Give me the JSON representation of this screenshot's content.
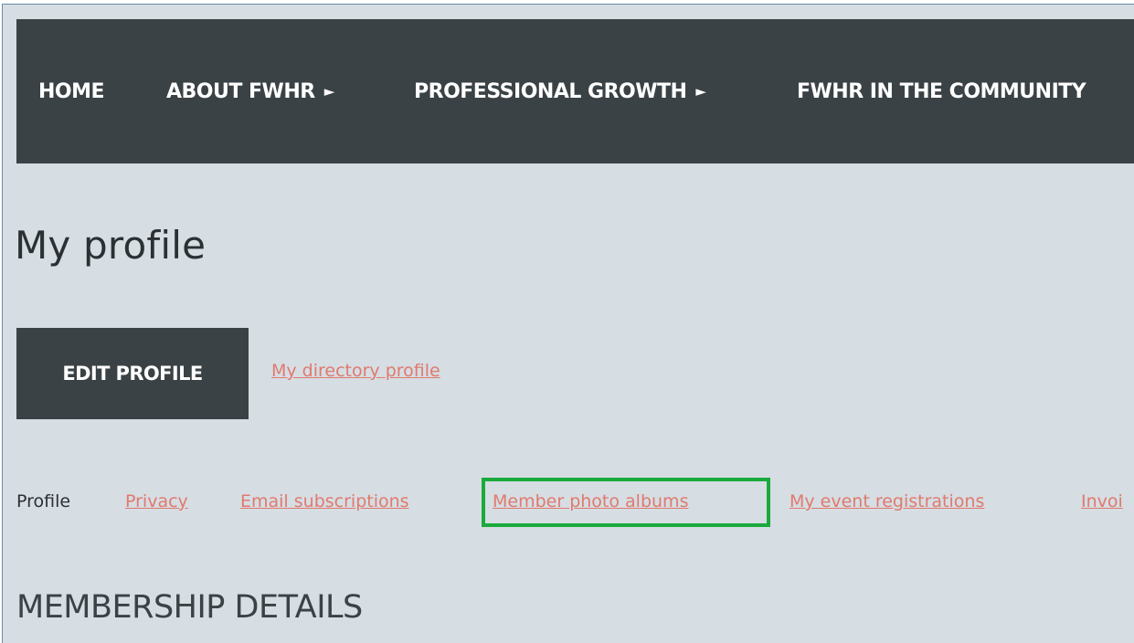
{
  "nav": {
    "items": [
      {
        "label": "HOME",
        "has_submenu": false,
        "arrow": ""
      },
      {
        "label": "ABOUT FWHR",
        "has_submenu": true,
        "arrow": "►"
      },
      {
        "label": "PROFESSIONAL GROWTH",
        "has_submenu": true,
        "arrow": "►"
      },
      {
        "label": "FWHR IN THE COMMUNITY",
        "has_submenu": false,
        "arrow": ""
      }
    ]
  },
  "page": {
    "title": "My profile",
    "edit_button_label": "EDIT PROFILE",
    "directory_link": "My directory profile"
  },
  "tabs": [
    {
      "label": "Profile",
      "active": true
    },
    {
      "label": "Privacy",
      "active": false
    },
    {
      "label": "Email subscriptions",
      "active": false
    },
    {
      "label": "Member photo albums",
      "active": false,
      "highlighted": true
    },
    {
      "label": "My event registrations",
      "active": false
    },
    {
      "label": "Invoi",
      "active": false
    }
  ],
  "section": {
    "title": "MEMBERSHIP DETAILS"
  },
  "colors": {
    "nav_background": "#3a4245",
    "page_background": "#d6dde3",
    "link": "#e07a6e",
    "highlight": "#1aaa3c"
  }
}
